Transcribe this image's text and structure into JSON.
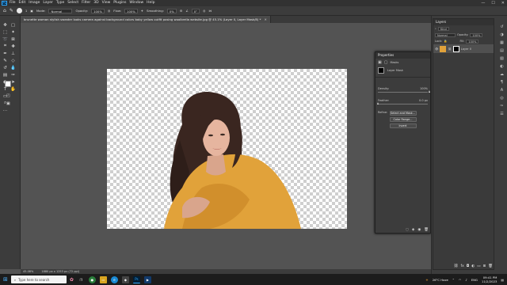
{
  "app": {
    "logo_text": "Ps",
    "menu": [
      "File",
      "Edit",
      "Image",
      "Layer",
      "Type",
      "Select",
      "Filter",
      "3D",
      "View",
      "Plugins",
      "Window",
      "Help"
    ],
    "window_controls": [
      "—",
      "☐",
      "✕"
    ]
  },
  "options_bar": {
    "brush_size": "1",
    "mode_label": "Mode:",
    "mode_value": "Normal",
    "opacity_label": "Opacity:",
    "opacity_value": "100%",
    "flow_label": "Flow:",
    "flow_value": "100%",
    "smoothing_label": "Smoothing:",
    "smoothing_value": "0%",
    "angle_value": "0°"
  },
  "document": {
    "tab_title": "brunette woman stylish sweater looks camera against background colors baby yellow outfit posing woolbrella website.jpg @ 45.1% (Layer 0, Layer Mask/8) *",
    "close_icon": "✕"
  },
  "status_bar": {
    "zoom": "45.08%",
    "doc_info": "1880 px x 1253 px (72 ppi)"
  },
  "layers_panel": {
    "title": "Layers",
    "kind_label": "Kind",
    "blend_mode": "Normal",
    "opacity_label": "Opacity:",
    "opacity_value": "100%",
    "lock_label": "Lock:",
    "fill_label": "Fill:",
    "fill_value": "100%",
    "layer_name": "Layer 0"
  },
  "properties_panel": {
    "title": "Properties",
    "section": "Masks",
    "mask_label": "Layer Mask",
    "density_label": "Density:",
    "density_value": "100%",
    "density_fraction": 1.0,
    "feather_label": "Feather:",
    "feather_value": "0.0 px",
    "feather_fraction": 0.0,
    "refine_label": "Refine:",
    "buttons": [
      "Select and Mask...",
      "Color Range...",
      "Invert"
    ]
  },
  "taskbar": {
    "search_placeholder": "Type here to search",
    "weather": "26°C  Haze",
    "language": "ENG",
    "time": "09:41 PM",
    "date": "11/2/2023"
  },
  "colors": {
    "menubar_bg": "#323232",
    "panel_bg": "#3c3c3c",
    "workspace_bg": "#535353",
    "accent": "#31a8ff",
    "sweater": "#e1a23a",
    "hair": "#3a2620"
  }
}
